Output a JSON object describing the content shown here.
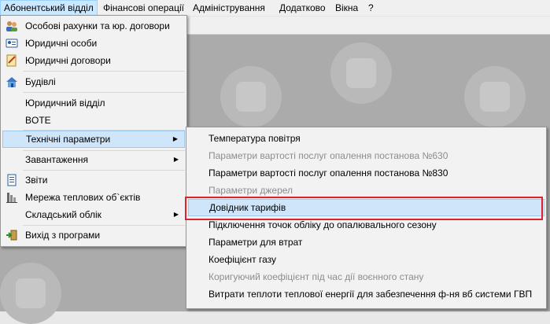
{
  "menubar": {
    "items": [
      "Абонентський відділ",
      "Фінансові операції",
      "Адміністрування",
      "Додатково",
      "Вікна",
      "?"
    ]
  },
  "main_menu": {
    "items": [
      {
        "label": "Особові рахунки та юр. договори",
        "icon": "people-icon"
      },
      {
        "label": "Юридичні особи",
        "icon": "id-card-icon"
      },
      {
        "label": "Юридичні договори",
        "icon": "contract-icon"
      },
      {
        "label": "Будівлі",
        "icon": "house-icon"
      },
      {
        "label": "Юридичний відділ",
        "icon": ""
      },
      {
        "label": "BOTE",
        "icon": ""
      },
      {
        "label": "Технічні параметри",
        "icon": ""
      },
      {
        "label": "Завантаження",
        "icon": ""
      },
      {
        "label": "Звіти",
        "icon": "report-icon"
      },
      {
        "label": "Мережа теплових об`єктів",
        "icon": "network-icon"
      },
      {
        "label": "Складський облік",
        "icon": ""
      },
      {
        "label": "Вихід з програми",
        "icon": "exit-icon"
      }
    ]
  },
  "submenu": {
    "items": [
      {
        "label": "Температура повітря",
        "enabled": true
      },
      {
        "label": "Параметри вартості послуг опалення постанова №630",
        "enabled": false
      },
      {
        "label": "Параметри вартості послуг опалення постанова №830",
        "enabled": true
      },
      {
        "label": "Параметри джерел",
        "enabled": false
      },
      {
        "label": "Довідник тарифів",
        "enabled": true
      },
      {
        "label": "Підключення точок обліку до опалювального сезону",
        "enabled": true
      },
      {
        "label": "Параметри для втрат",
        "enabled": true
      },
      {
        "label": "Коефіцієнт газу",
        "enabled": true
      },
      {
        "label": "Коригуючий коефіцієнт під час дії воєнного стану",
        "enabled": false
      },
      {
        "label": "Витрати теплоти теплової енергії для забезпечення ф-ня вб системи ГВП",
        "enabled": true
      }
    ]
  },
  "colors": {
    "highlight": "#cfe5f9",
    "callout": "#e0202a",
    "mdi_background": "#ababab"
  }
}
